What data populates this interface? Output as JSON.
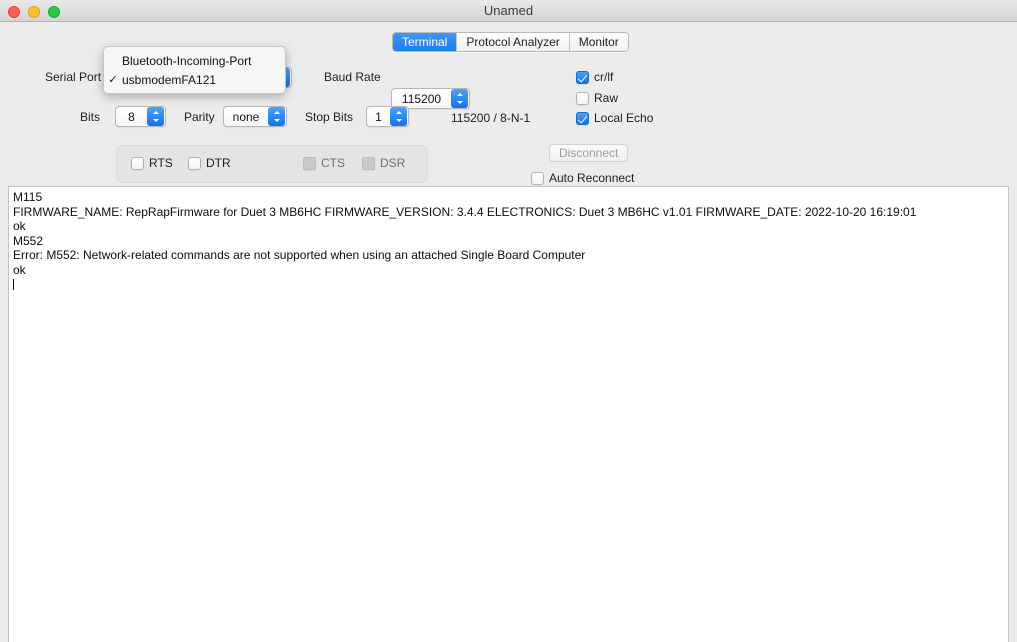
{
  "window": {
    "title": "Unamed",
    "traffic_lights": [
      {
        "name": "close",
        "color": "#ff5f57"
      },
      {
        "name": "minimize",
        "color": "#febc2e"
      },
      {
        "name": "maximize",
        "color": "#28c840"
      }
    ]
  },
  "tabs": [
    {
      "label": "Terminal",
      "active": true
    },
    {
      "label": "Protocol Analyzer",
      "active": false
    },
    {
      "label": "Monitor",
      "active": false
    }
  ],
  "settings": {
    "serial_port_label": "Serial Port",
    "serial_port_value": "usbmodemFA121",
    "baud_rate_label": "Baud Rate",
    "baud_rate_value": "115200",
    "bits_label": "Bits",
    "bits_value": "8",
    "parity_label": "Parity",
    "parity_value": "none",
    "stop_bits_label": "Stop Bits",
    "stop_bits_value": "1",
    "status_summary": "115200 / 8-N-1"
  },
  "options": {
    "crlf_label": "cr/lf",
    "crlf_checked": true,
    "raw_label": "Raw",
    "raw_checked": false,
    "local_echo_label": "Local Echo",
    "local_echo_checked": true,
    "auto_reconnect_label": "Auto Reconnect",
    "auto_reconnect_checked": false
  },
  "connection": {
    "disconnect_label": "Disconnect",
    "disconnect_enabled": false
  },
  "signals": [
    {
      "label": "RTS",
      "type": "checkbox",
      "checked": false
    },
    {
      "label": "DTR",
      "type": "checkbox",
      "checked": false
    },
    {
      "label": "CTS",
      "type": "indicator",
      "checked": false
    },
    {
      "label": "DSR",
      "type": "indicator",
      "checked": false
    }
  ],
  "port_menu": {
    "items": [
      {
        "label": "Bluetooth-Incoming-Port",
        "checked": false
      },
      {
        "label": "usbmodemFA121",
        "checked": true
      }
    ],
    "check_glyph": "✓"
  },
  "terminal": {
    "lines": [
      "M115",
      "FIRMWARE_NAME: RepRapFirmware for Duet 3 MB6HC FIRMWARE_VERSION: 3.4.4 ELECTRONICS: Duet 3 MB6HC v1.01 FIRMWARE_DATE: 2022-10-20 16:19:01",
      "ok",
      "M552",
      "Error: M552: Network-related commands are not supported when using an attached Single Board Computer",
      "ok"
    ]
  },
  "colors": {
    "accent": "#1472ec",
    "window_bg": "#ececec",
    "terminal_bg": "#ffffff"
  }
}
